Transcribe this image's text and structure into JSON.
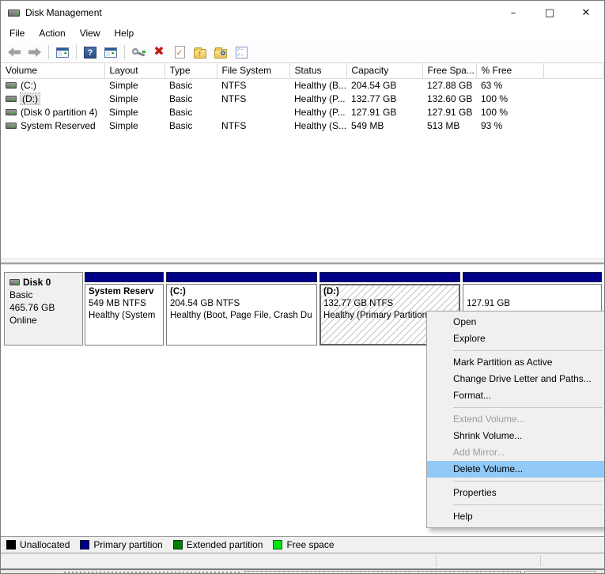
{
  "window": {
    "title": "Disk Management",
    "controls": {
      "minimize": "–",
      "maximize": "□",
      "close": "✕"
    }
  },
  "menubar": {
    "items": [
      "File",
      "Action",
      "View",
      "Help"
    ]
  },
  "toolbar": {
    "icons": [
      "back",
      "forward",
      "show-console-tree",
      "help",
      "show-action-pane",
      "rescan",
      "delete",
      "verify",
      "open-parent",
      "find",
      "properties"
    ]
  },
  "volume_table": {
    "columns": [
      "Volume",
      "Layout",
      "Type",
      "File System",
      "Status",
      "Capacity",
      "Free Spa...",
      "% Free"
    ],
    "rows": [
      {
        "volume": "(C:)",
        "layout": "Simple",
        "type": "Basic",
        "fs": "NTFS",
        "status": "Healthy (B...",
        "capacity": "204.54 GB",
        "free": "127.88 GB",
        "pct": "63 %"
      },
      {
        "volume": "(D:)",
        "layout": "Simple",
        "type": "Basic",
        "fs": "NTFS",
        "status": "Healthy (P...",
        "capacity": "132.77 GB",
        "free": "132.60 GB",
        "pct": "100 %"
      },
      {
        "volume": "(Disk 0 partition 4)",
        "layout": "Simple",
        "type": "Basic",
        "fs": "",
        "status": "Healthy (P...",
        "capacity": "127.91 GB",
        "free": "127.91 GB",
        "pct": "100 %"
      },
      {
        "volume": "System Reserved",
        "layout": "Simple",
        "type": "Basic",
        "fs": "NTFS",
        "status": "Healthy (S...",
        "capacity": "549 MB",
        "free": "513 MB",
        "pct": "93 %"
      }
    ]
  },
  "disk_view": {
    "disk": {
      "name": "Disk 0",
      "type": "Basic",
      "size": "465.76 GB",
      "status": "Online"
    },
    "partitions": [
      {
        "name": "System Reserv",
        "size_fs": "549 MB NTFS",
        "status": "Healthy (System",
        "selected": false
      },
      {
        "name": "(C:)",
        "size_fs": "204.54 GB NTFS",
        "status": "Healthy (Boot, Page File, Crash Du",
        "selected": false
      },
      {
        "name": "(D:)",
        "size_fs": "132.77 GB NTFS",
        "status": "Healthy (Primary Partition",
        "selected": true
      },
      {
        "name": "",
        "size_fs": "127.91 GB",
        "status": "",
        "selected": false
      }
    ]
  },
  "context_menu": {
    "items": [
      {
        "label": "Open",
        "state": "normal"
      },
      {
        "label": "Explore",
        "state": "normal"
      },
      {
        "label": "Mark Partition as Active",
        "state": "normal"
      },
      {
        "label": "Change Drive Letter and Paths...",
        "state": "normal"
      },
      {
        "label": "Format...",
        "state": "normal"
      },
      {
        "label": "Extend Volume...",
        "state": "disabled"
      },
      {
        "label": "Shrink Volume...",
        "state": "normal"
      },
      {
        "label": "Add Mirror...",
        "state": "disabled"
      },
      {
        "label": "Delete Volume...",
        "state": "highlighted"
      },
      {
        "label": "Properties",
        "state": "normal"
      },
      {
        "label": "Help",
        "state": "normal"
      }
    ]
  },
  "legend": {
    "items": [
      {
        "label": "Unallocated",
        "color": "#000000"
      },
      {
        "label": "Primary partition",
        "color": "#000080"
      },
      {
        "label": "Extended partition",
        "color": "#008000"
      },
      {
        "label": "Free space",
        "color": "#00e410"
      }
    ]
  },
  "colors": {
    "primary_partition": "#000089",
    "menu_highlight": "#91c9f7",
    "disabled_text": "#9b9b9b"
  }
}
